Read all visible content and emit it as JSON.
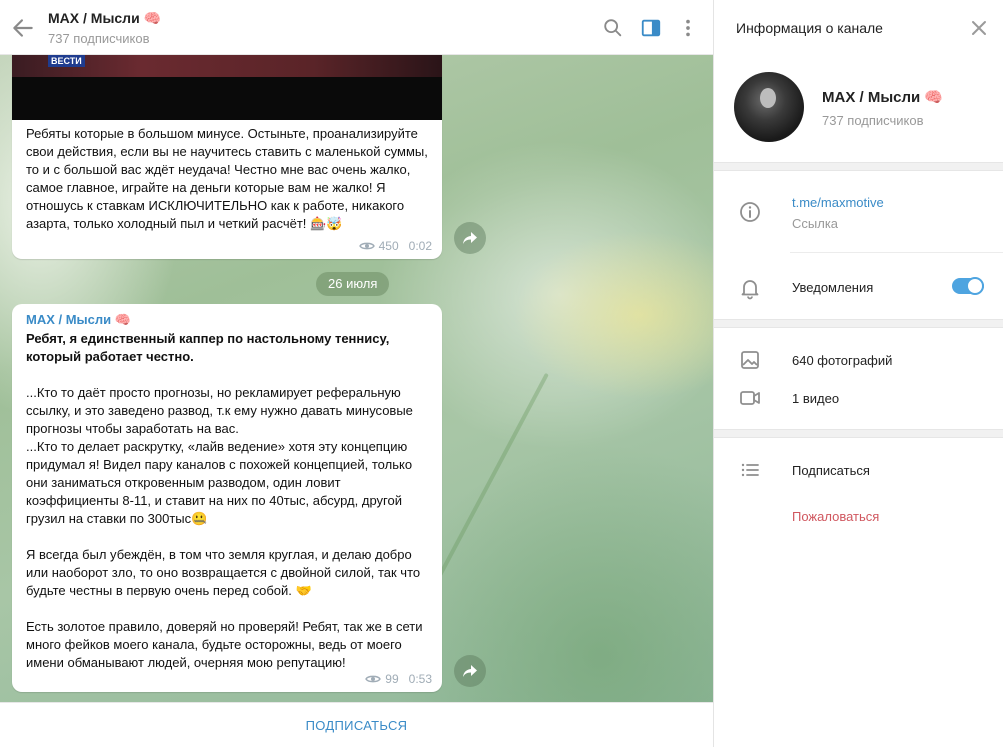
{
  "header": {
    "title": "MAX / Мысли 🧠",
    "subscribers": "737 подписчиков"
  },
  "messages": [
    {
      "text": "Ребяты которые в большом минусе. Остыньте, проанализируйте свои действия, если вы не научитесь ставить с маленькой суммы, то и с большой вас ждёт неудача! Честно мне вас очень жалко, самое главное, играйте на деньги которые вам не жалко! Я отношусь к ставкам ИСКЛЮЧИТЕЛЬНО как к работе, никакого азарта, только холодный пыл и четкий расчёт! 🎰🤯",
      "views": "450",
      "time": "0:02",
      "video_label": "ВЕСТИ"
    },
    {
      "sender": "MAX / Мысли 🧠",
      "lead": "Ребят, я единственный каппер по настольному теннису, который работает честно.",
      "body": "...Кто то даёт просто прогнозы, но рекламирует реферальную ссылку, и это заведено развод, т.к ему нужно давать минусовые прогнозы чтобы заработать на вас.\n...Кто то делает раскрутку, «лайв ведение» хотя эту концепцию придумал я! Видел пару каналов с похожей концепцией, только они заниматься откровенным разводом, один ловит коэффициенты 8-11, и ставит на них по 40тыс, абсурд, другой грузил на ставки по 300тыс🤐\n\nЯ всегда был убеждён, в том что земля круглая, и делаю добро или наоборот зло, то оно возвращается с двойной силой, так что будьте честны в первую очень перед собой. 🤝\n\nЕсть золотое правило, доверяй но проверяй! Ребят, так же в сети много фейков моего канала, будьте осторожны, ведь от моего имени обманывают людей, очерняя мою репутацию!",
      "views": "99",
      "time": "0:53"
    }
  ],
  "date_separator": "26 июля",
  "subscribe_button": "ПОДПИСАТЬСЯ",
  "panel": {
    "title": "Информация о канале",
    "name": "MAX / Мысли 🧠",
    "subscribers": "737 подписчиков",
    "link": "t.me/maxmotive",
    "link_hint": "Ссылка",
    "notifications": "Уведомления",
    "notifications_on": true,
    "photos": "640 фотографий",
    "videos": "1 видео",
    "subscribe": "Подписаться",
    "report": "Пожаловаться"
  },
  "colors": {
    "accent": "#3a8bc7",
    "toggle": "#4ea4e0",
    "danger": "#d0575f"
  },
  "icons": [
    "back-arrow-icon",
    "search-icon",
    "sidebar-toggle-icon",
    "more-vertical-icon",
    "close-icon",
    "info-icon",
    "bell-icon",
    "photo-icon",
    "video-icon",
    "list-icon",
    "share-icon",
    "eye-icon"
  ]
}
